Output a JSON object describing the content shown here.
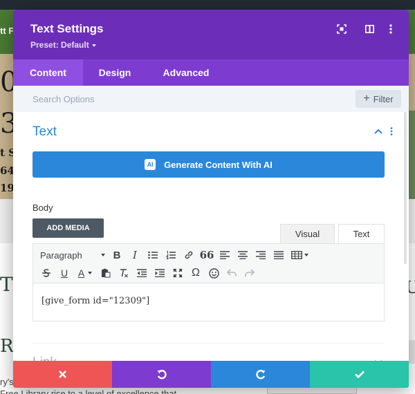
{
  "background": {
    "nav_fragment": "tt F",
    "hero_fragments": [
      "0",
      "3",
      "t S",
      "64",
      "19"
    ],
    "lower_fragments": [
      "TC",
      "U",
      "R D",
      "ry's",
      "Free Library rise to a level of excellence that"
    ]
  },
  "modal": {
    "title": "Text Settings",
    "preset": "Preset: Default",
    "tabs": [
      {
        "label": "Content",
        "active": true
      },
      {
        "label": "Design",
        "active": false
      },
      {
        "label": "Advanced",
        "active": false
      }
    ],
    "search": {
      "placeholder": "Search Options",
      "filter_label": "Filter"
    },
    "section": {
      "title": "Text",
      "ai_button": "Generate Content With AI",
      "ai_badge": "AI",
      "body_label": "Body",
      "add_media": "ADD MEDIA",
      "editor_tabs": {
        "visual": "Visual",
        "text": "Text"
      },
      "format_select": "Paragraph",
      "editor_content": "[give_form id=\"12309\"]",
      "toolbar_glyphs": {
        "bold": "B",
        "italic": "I",
        "quote": "66",
        "omega": "Ω",
        "underline": "U",
        "text_color": "A"
      }
    },
    "link_section": {
      "title": "Link"
    }
  },
  "colors": {
    "header": "#6c2eb9",
    "tabs": "#7d3bcf",
    "accent_blue": "#2b87da",
    "cancel": "#ef5555",
    "save": "#29c4a9"
  },
  "icons": {
    "header": [
      "expand-icon",
      "columns-icon",
      "kebab-menu-icon"
    ],
    "footer": [
      "close-icon",
      "undo-icon",
      "redo-icon",
      "check-icon"
    ]
  }
}
